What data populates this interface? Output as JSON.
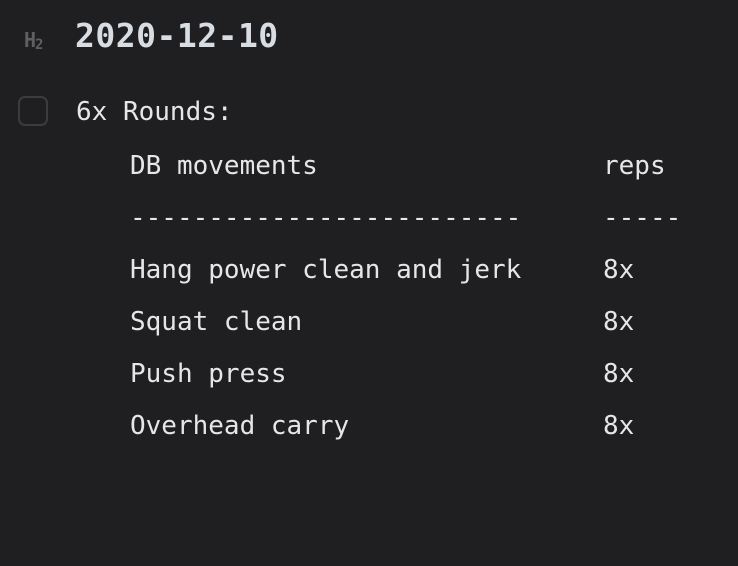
{
  "heading": {
    "marker_h": "H",
    "marker_level": "2",
    "title": "2020-12-10"
  },
  "task": {
    "checked": false,
    "label": "6x Rounds:"
  },
  "table": {
    "headers": [
      "DB movements",
      "reps"
    ],
    "separator": [
      "-------------------------",
      "-----"
    ],
    "rows": [
      [
        "Hang power clean and jerk",
        "8x"
      ],
      [
        "Squat clean",
        "8x"
      ],
      [
        "Push press",
        "8x"
      ],
      [
        "Overhead carry",
        "8x"
      ]
    ]
  }
}
